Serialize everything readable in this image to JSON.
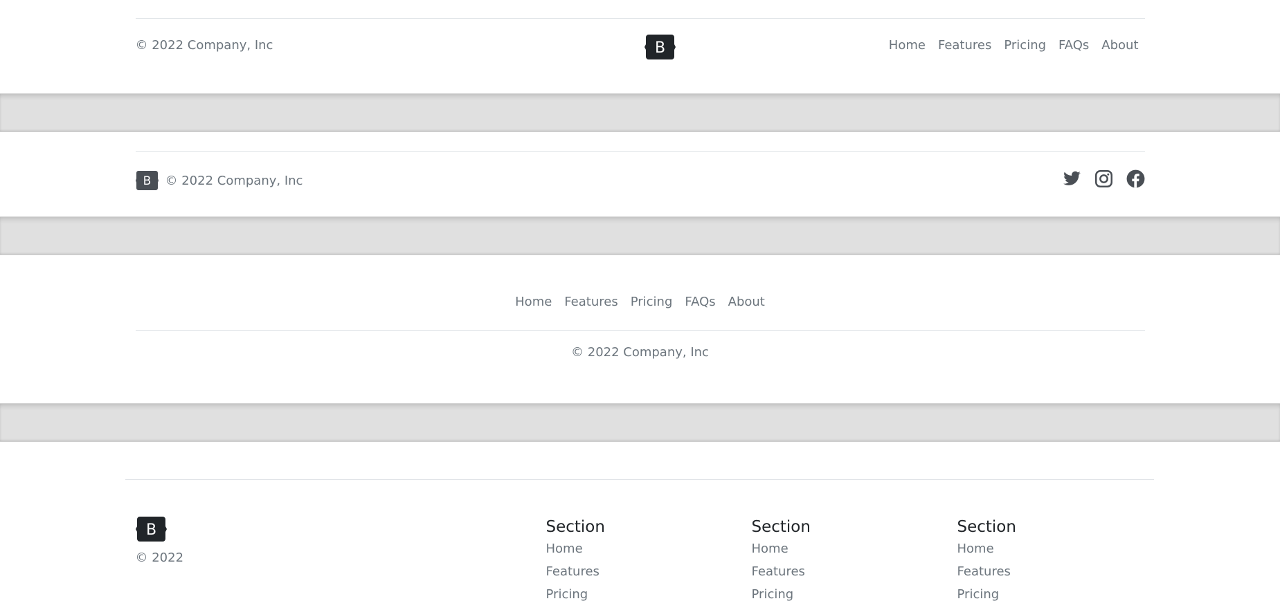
{
  "brand": {
    "logo_letter": "B",
    "logo_color": "#212529",
    "logo_color_muted": "#4a4f55"
  },
  "footer1": {
    "copyright": "© 2022 Company, Inc",
    "nav": [
      "Home",
      "Features",
      "Pricing",
      "FAQs",
      "About"
    ]
  },
  "footer2": {
    "copyright": "© 2022 Company, Inc",
    "social": [
      "twitter-icon",
      "instagram-icon",
      "facebook-icon"
    ]
  },
  "footer3": {
    "nav": [
      "Home",
      "Features",
      "Pricing",
      "FAQs",
      "About"
    ],
    "copyright": "© 2022 Company, Inc"
  },
  "footer4": {
    "copyright": "© 2022",
    "columns": [
      {
        "title": "Section",
        "items": [
          "Home",
          "Features",
          "Pricing"
        ]
      },
      {
        "title": "Section",
        "items": [
          "Home",
          "Features",
          "Pricing"
        ]
      },
      {
        "title": "Section",
        "items": [
          "Home",
          "Features",
          "Pricing"
        ]
      }
    ]
  },
  "colors": {
    "text_muted": "#6c757d",
    "heading": "#212529",
    "divider_band": "#e0e0e0",
    "rule": "#dee2e6"
  }
}
